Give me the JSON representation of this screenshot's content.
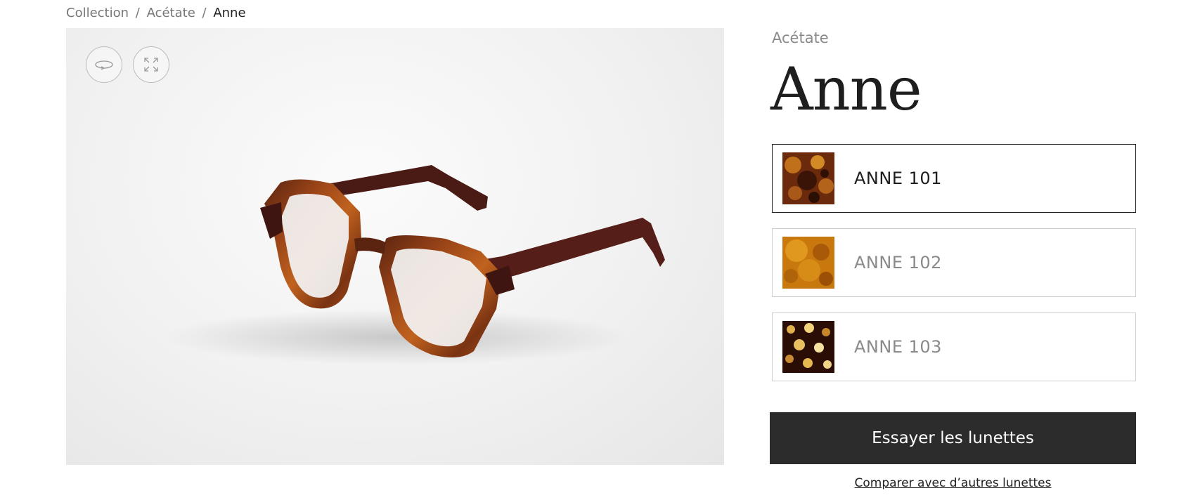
{
  "breadcrumb": {
    "items": [
      "Collection",
      "Acétate"
    ],
    "separator": "/",
    "current": "Anne"
  },
  "viewer": {
    "buttons": [
      {
        "icon": "rotate-360-icon"
      },
      {
        "icon": "expand-icon"
      }
    ],
    "image_alt": "Anne 101 eyeglasses"
  },
  "product": {
    "material": "Acétate",
    "name": "Anne"
  },
  "variants": [
    {
      "label": "ANNE 101",
      "selected": true,
      "swatch": "dark-tortoise"
    },
    {
      "label": "ANNE 102",
      "selected": false,
      "swatch": "honey-tortoise"
    },
    {
      "label": "ANNE 103",
      "selected": false,
      "swatch": "spotted-tortoise"
    }
  ],
  "cta": {
    "label": "Essayer les lunettes"
  },
  "compare": {
    "label": "Comparer avec d’autres lunettes"
  },
  "colors": {
    "cta_bg": "#2c2c2c",
    "selected_border": "#222222",
    "border": "#cfcfcf",
    "muted_text": "#8a8a8a"
  }
}
